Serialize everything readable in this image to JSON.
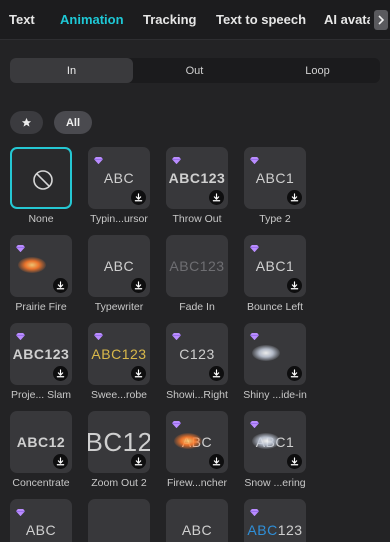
{
  "tabs": [
    {
      "label": "Text",
      "active": false
    },
    {
      "label": "Animation",
      "active": true
    },
    {
      "label": "Tracking",
      "active": false
    },
    {
      "label": "Text to speech",
      "active": false
    },
    {
      "label": "AI avata",
      "active": false
    }
  ],
  "segments": [
    {
      "label": "In",
      "active": true
    },
    {
      "label": "Out",
      "active": false
    },
    {
      "label": "Loop",
      "active": false
    }
  ],
  "filters": {
    "favorites_icon": "star-icon",
    "all_label": "All"
  },
  "colors": {
    "accent": "#1ec8d6",
    "premium": "#b98cff",
    "background": "#232325"
  },
  "animations": [
    {
      "label": "None",
      "preview": "",
      "premium": false,
      "download": false,
      "selected": true
    },
    {
      "label": "Typin...ursor",
      "preview": "ABC",
      "premium": true,
      "download": true,
      "selected": false
    },
    {
      "label": "Throw Out",
      "preview": "ABC123",
      "premium": true,
      "download": true,
      "selected": false
    },
    {
      "label": "Type 2",
      "preview": "ABC1",
      "premium": true,
      "download": true,
      "selected": false
    },
    {
      "label": "Prairie Fire",
      "preview": "",
      "premium": true,
      "download": true,
      "selected": false
    },
    {
      "label": "Typewriter",
      "preview": "ABC",
      "premium": false,
      "download": true,
      "selected": false
    },
    {
      "label": "Fade In",
      "preview": "ABC123",
      "premium": false,
      "download": false,
      "selected": false
    },
    {
      "label": "Bounce Left",
      "preview": "ABC1",
      "premium": true,
      "download": true,
      "selected": false
    },
    {
      "label": "Proje... Slam",
      "preview": "ABC123",
      "premium": true,
      "download": true,
      "selected": false
    },
    {
      "label": "Swee...robe",
      "preview": "ABC123",
      "premium": true,
      "download": true,
      "selected": false
    },
    {
      "label": "Showi...Right",
      "preview": "C123",
      "premium": true,
      "download": true,
      "selected": false
    },
    {
      "label": "Shiny ...ide-in",
      "preview": "",
      "premium": true,
      "download": true,
      "selected": false
    },
    {
      "label": "Concentrate",
      "preview": "ABC12",
      "premium": false,
      "download": true,
      "selected": false
    },
    {
      "label": "Zoom Out 2",
      "preview": "BC12",
      "premium": false,
      "download": true,
      "selected": false
    },
    {
      "label": "Firew...ncher",
      "preview": "ABC",
      "premium": true,
      "download": true,
      "selected": false
    },
    {
      "label": "Snow ...ering",
      "preview": "ABC1",
      "premium": true,
      "download": true,
      "selected": false
    },
    {
      "label": "",
      "preview": "ABC",
      "premium": true,
      "download": false,
      "selected": false
    },
    {
      "label": "",
      "preview": "",
      "premium": false,
      "download": false,
      "selected": false
    },
    {
      "label": "",
      "preview": "ABC",
      "premium": false,
      "download": false,
      "selected": false
    },
    {
      "label": "",
      "preview": "ABC123",
      "premium": true,
      "download": false,
      "selected": false
    }
  ]
}
